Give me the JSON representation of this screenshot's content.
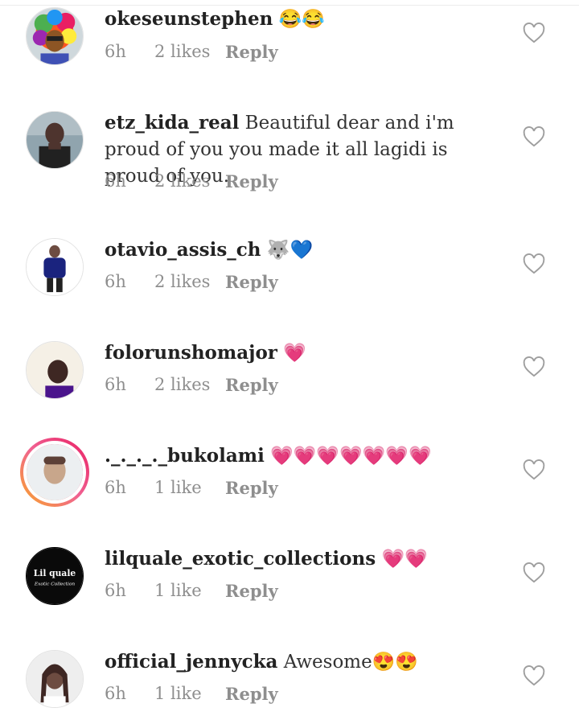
{
  "comments": [
    {
      "username": "okeseunstephen",
      "text": " 😂😂",
      "time": "6h",
      "likes": "2 likes",
      "reply": "Reply",
      "avatar_icon": "rainbow-wig-avatar"
    },
    {
      "username": "etz_kida_real",
      "text": " Beautiful dear and i'm proud of you you made it all lagidi is proud of you.",
      "time": "6h",
      "likes": "2 likes",
      "reply": "Reply",
      "avatar_icon": "man-dark-shirt-avatar"
    },
    {
      "username": "otavio_assis_ch",
      "text": " 🐺💙",
      "time": "6h",
      "likes": "2 likes",
      "reply": "Reply",
      "avatar_icon": "man-blue-hoodie-avatar"
    },
    {
      "username": "folorunshomajor",
      "text": " 💗",
      "time": "6h",
      "likes": "2 likes",
      "reply": "Reply",
      "avatar_icon": "man-selfie-avatar"
    },
    {
      "username": "._._._._bukolami",
      "text": " 💗💗💗💗💗💗💗",
      "time": "6h",
      "likes": "1 like",
      "reply": "Reply",
      "avatar_icon": "woman-portrait-avatar"
    },
    {
      "username": "lilquale_exotic_collections",
      "text": " 💗💗",
      "time": "6h",
      "likes": "1 like",
      "reply": "Reply",
      "avatar_icon": "lil-quale-logo-avatar",
      "logo_text": "Lil quale",
      "logo_subtext": "Exotic Collection"
    },
    {
      "username": "official_jennycka",
      "text": " Awesome😍😍",
      "time": "6h",
      "likes": "1 like",
      "reply": "Reply",
      "avatar_icon": "woman-braids-avatar"
    }
  ],
  "like_icon": "heart-outline-icon",
  "colors": {
    "meta": "#8e8e8e",
    "story_ring": "#e91e63",
    "heart": "#e84b88"
  }
}
